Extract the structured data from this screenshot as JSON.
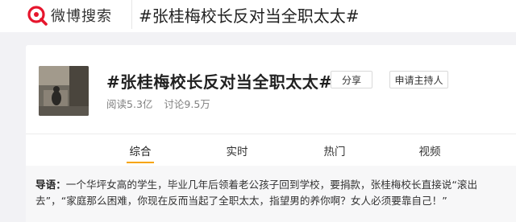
{
  "header": {
    "logo_text": "微博搜索",
    "search_value": "#张桂梅校长反对当全职太太#"
  },
  "topic": {
    "title": "#张桂梅校长反对当全职太太#",
    "share_label": "分享",
    "apply_host_label": "申请主持人",
    "reads_label": "阅读",
    "reads_value": "5.3亿",
    "discussion_label": "讨论",
    "discussion_value": "9.5万"
  },
  "tabs": [
    {
      "label": "综合",
      "active": true
    },
    {
      "label": "实时",
      "active": false
    },
    {
      "label": "热门",
      "active": false
    },
    {
      "label": "视频",
      "active": false
    }
  ],
  "guide": {
    "label": "导语：",
    "text": "一个华坪女高的学生，毕业几年后领着老公孩子回到学校，要捐款，张桂梅校长直接说“滚出去”，“家庭那么困难，你现在反而当起了全职太太，指望男的养你啊？女人必须要靠自己！”"
  },
  "colors": {
    "accent": "#f7a400",
    "logo_red": "#e6162d"
  }
}
